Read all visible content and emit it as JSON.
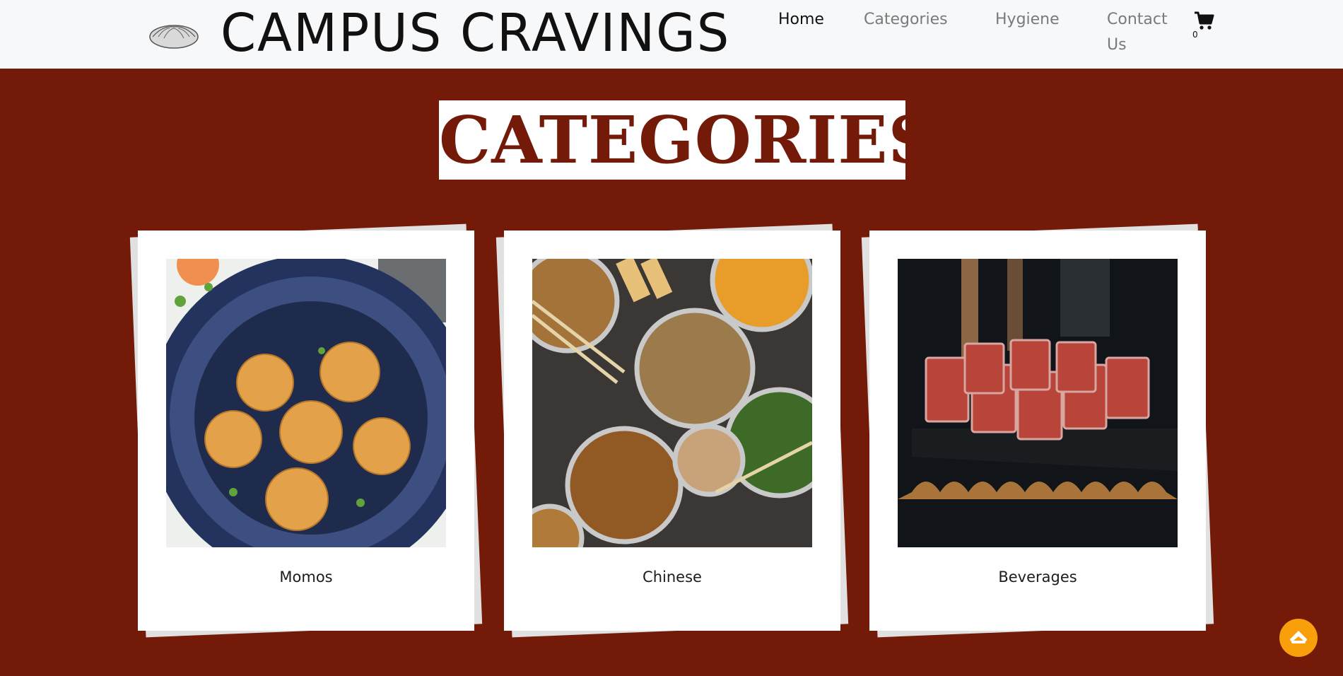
{
  "header": {
    "brand": "CAMPUS CRAVINGS",
    "logo_icon": "dumpling-icon",
    "nav": {
      "home": "Home",
      "categories": "Categories",
      "hygiene": "Hygiene",
      "contact": "Contact Us"
    },
    "cart_icon": "shopping-cart-icon",
    "cart_count": "0"
  },
  "main": {
    "heading": "CATEGORIES",
    "cards": [
      {
        "label": "Momos",
        "image": "momos-photo"
      },
      {
        "label": "Chinese",
        "image": "chinese-food-photo"
      },
      {
        "label": "Beverages",
        "image": "beverages-photo"
      }
    ]
  },
  "scroll_top_icon": "arrow-up-icon",
  "colors": {
    "background": "#731a08",
    "header_bg": "#f7f8fa",
    "accent": "#fa9f0c",
    "heading_text": "#731a08"
  }
}
